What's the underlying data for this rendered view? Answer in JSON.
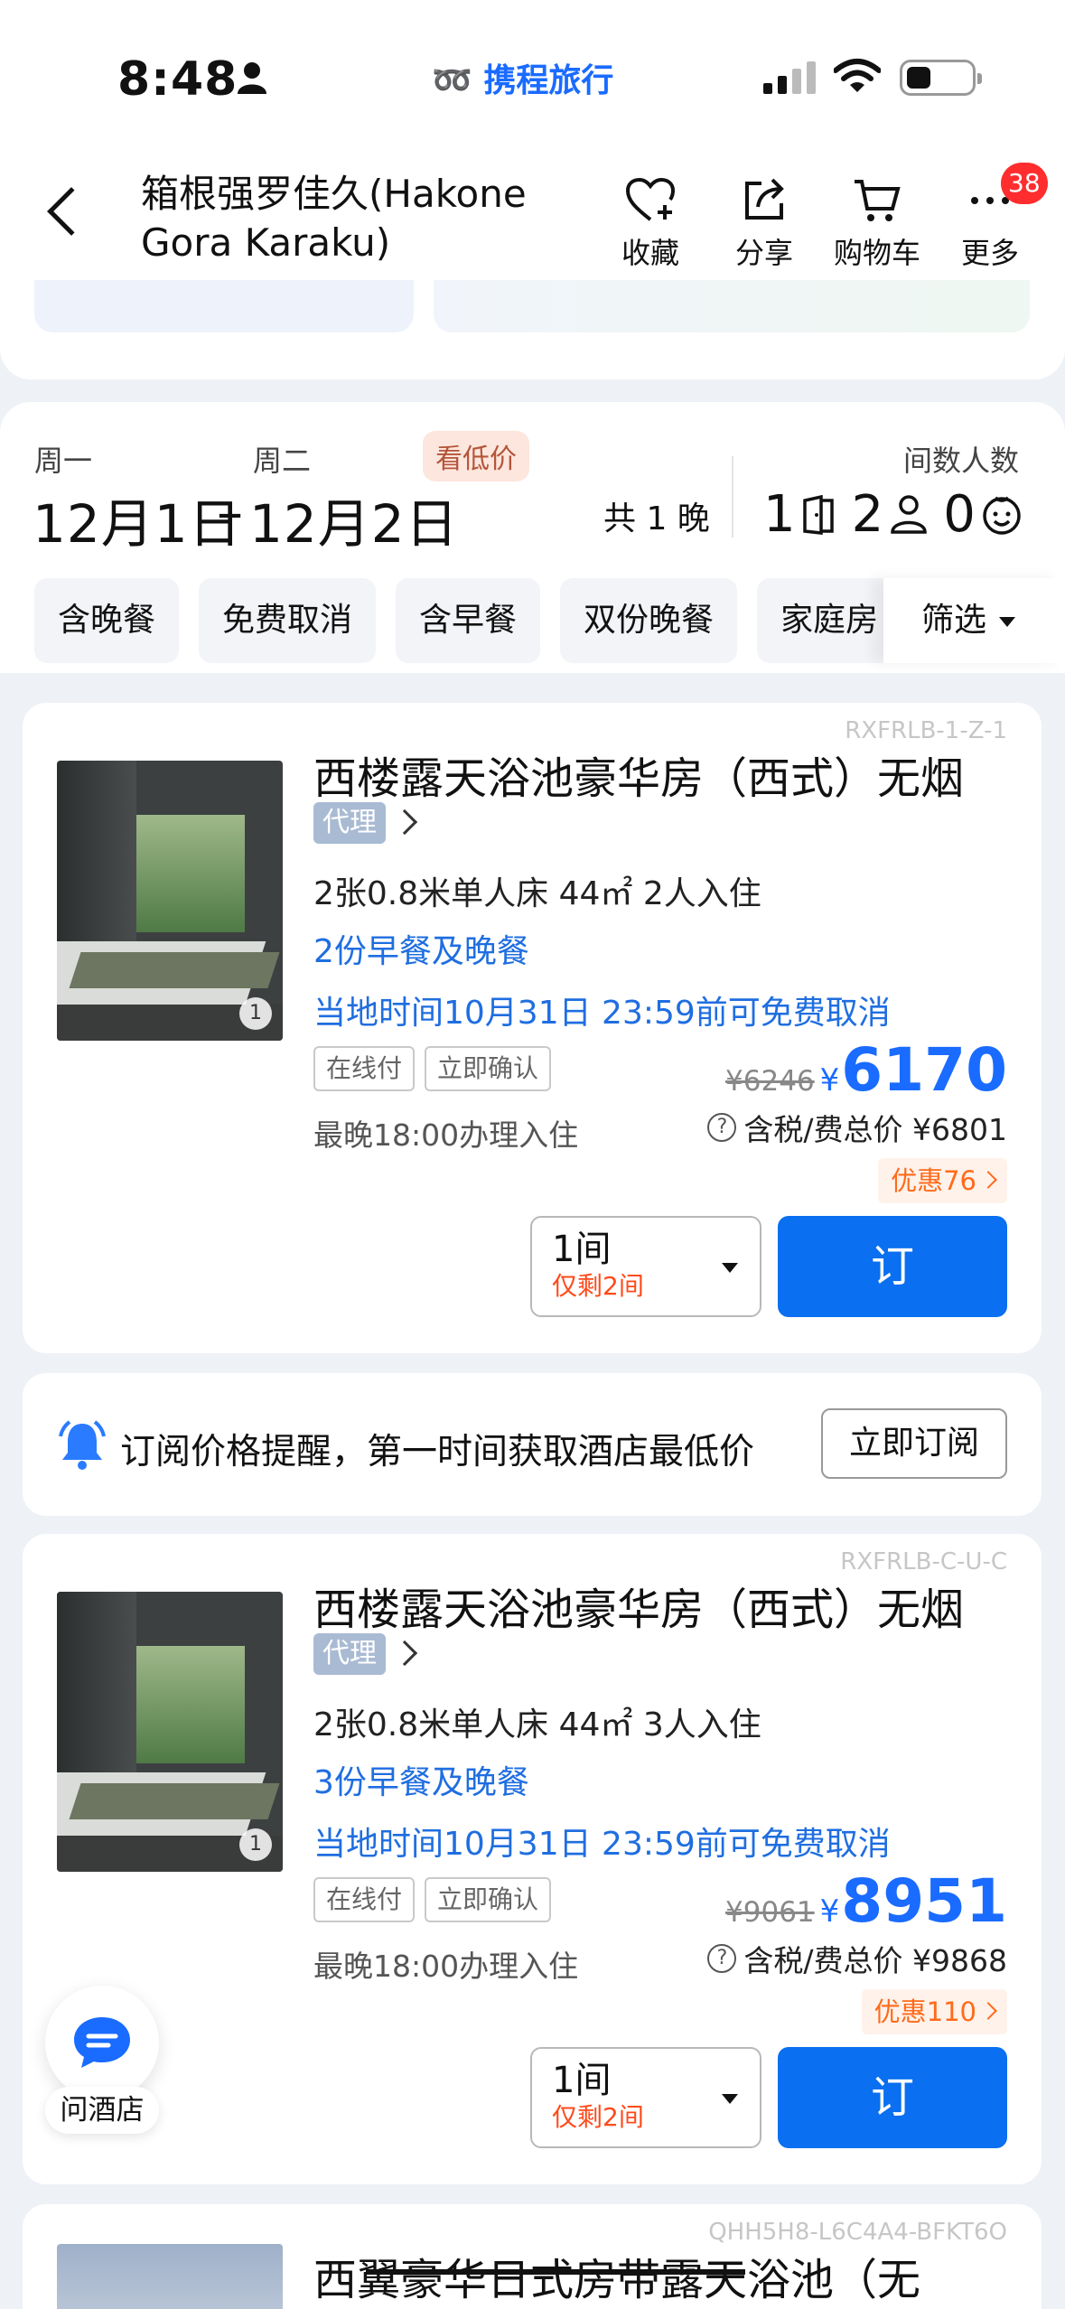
{
  "status_bar": {
    "time": "8:48",
    "brand": "携程旅行"
  },
  "header": {
    "title": "箱根强罗佳久(Hakone Gora Karaku)",
    "actions": [
      {
        "label": "收藏",
        "icon": "heart-plus-icon"
      },
      {
        "label": "分享",
        "icon": "share-icon"
      },
      {
        "label": "购物车",
        "icon": "cart-icon"
      },
      {
        "label": "更多",
        "icon": "more-icon"
      }
    ],
    "badge": "38"
  },
  "dates": {
    "checkin_weekday": "周一",
    "checkout_weekday": "周二",
    "checkin": "12月1日",
    "dash": "–",
    "checkout": "12月2日",
    "low_price_label": "看低价",
    "nights": "共 1 晚",
    "rooms_guests_label": "间数人数",
    "rooms": "1",
    "adults": "2",
    "children": "0"
  },
  "filters": {
    "chips": [
      "含晚餐",
      "免费取消",
      "含早餐",
      "双份晚餐",
      "家庭房"
    ],
    "filter_label": "筛选"
  },
  "rooms": [
    {
      "code": "RXFRLB-1-Z-1",
      "name": "西楼露天浴池豪华房（西式）无烟",
      "agent": "代理",
      "spec": "2张0.8米单人床   44㎡   2人入住",
      "meal": "2份早餐及晚餐",
      "cancel": "当地时间10月31日 23:59前可免费取消",
      "tags": [
        "在线付",
        "立即确认"
      ],
      "checkin_note": "最晚18:00办理入住",
      "original_price": "¥6246",
      "currency": "¥",
      "price": "6170",
      "total_label": "含税/费总价 ¥6801",
      "promo": "优惠76",
      "qty": "1间",
      "remaining": "仅剩2间",
      "book": "订",
      "photo_count": "1"
    },
    {
      "code": "RXFRLB-C-U-C",
      "name": "西楼露天浴池豪华房（西式）无烟",
      "agent": "代理",
      "spec": "2张0.8米单人床   44㎡   3人入住",
      "meal": "3份早餐及晚餐",
      "cancel": "当地时间10月31日 23:59前可免费取消",
      "tags": [
        "在线付",
        "立即确认"
      ],
      "checkin_note": "最晚18:00办理入住",
      "original_price": "¥9061",
      "currency": "¥",
      "price": "8951",
      "total_label": "含税/费总价 ¥9868",
      "promo": "优惠110",
      "qty": "1间",
      "remaining": "仅剩2间",
      "book": "订",
      "photo_count": "1"
    }
  ],
  "subscribe": {
    "text": "订阅价格提醒，第一时间获取酒店最低价",
    "button": "立即订阅"
  },
  "ask": {
    "label": "问酒店"
  },
  "partial_room": {
    "code": "QHH5H8-L6C4A4-BFKT6O",
    "name": "西翼豪华日式房带露天浴池（无"
  },
  "colors": {
    "accent": "#1a6bff",
    "promo": "#ff6a1a",
    "button": "#0a6ff0"
  }
}
